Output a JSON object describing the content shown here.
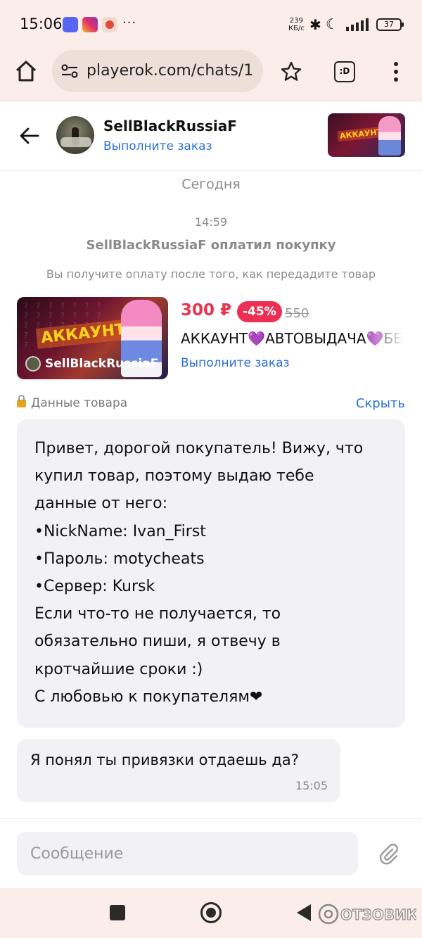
{
  "status_bar": {
    "time": "15:06",
    "more_indicator": "···",
    "net_speed_value": "239",
    "net_speed_unit": "КБ/с",
    "battery": "37",
    "icons": [
      "discord-icon",
      "instagram-icon",
      "app-icon",
      "bluetooth-icon",
      "moon-icon",
      "signal-icon",
      "battery-icon"
    ]
  },
  "browser": {
    "url": "playerok.com/chats/1",
    "tabs_label": ":D"
  },
  "chat_header": {
    "seller_name": "SellBlackRussiaF",
    "status": "Выполните заказ"
  },
  "thread": {
    "date_label": "Сегодня",
    "system_time": "14:59",
    "system_title": "SellBlackRussiaF оплатил покупку",
    "system_note": "Вы получите оплату после того, как передадите товар"
  },
  "product": {
    "image_tag": "АККАУНТ",
    "image_brand": "SellBlackRussiaF",
    "price": "300 ₽",
    "discount": "-45%",
    "old_price": "550",
    "title": "АККАУНТ💜АВТОВЫДАЧА💜БЕ",
    "status": "Выполните заказ"
  },
  "item_data": {
    "label": "Данные товара",
    "hide_link": "Скрыть"
  },
  "messages": [
    {
      "text": "Привет, дорогой покупатель! Вижу, что\nкупил товар, поэтому выдаю тебе\nданные от него:\n•NickName: Ivan_First\n•Пароль: motycheats\n•Сервер: Kursk\nЕсли что-то не получается, то\nобязательно пиши, я отвечу в\nкротчайшие сроки :)\nС любовью к покупателям❤"
    },
    {
      "text": "Я понял ты привязки отдаешь да?",
      "time": "15:05"
    }
  ],
  "composer": {
    "placeholder": "Сообщение"
  },
  "colors": {
    "link_blue": "#2a6fd6",
    "price_red": "#e8344e",
    "discount_bg": "#ee2f55",
    "bubble_bg": "#f2f2f6",
    "chrome_bg": "#fbeeea"
  }
}
